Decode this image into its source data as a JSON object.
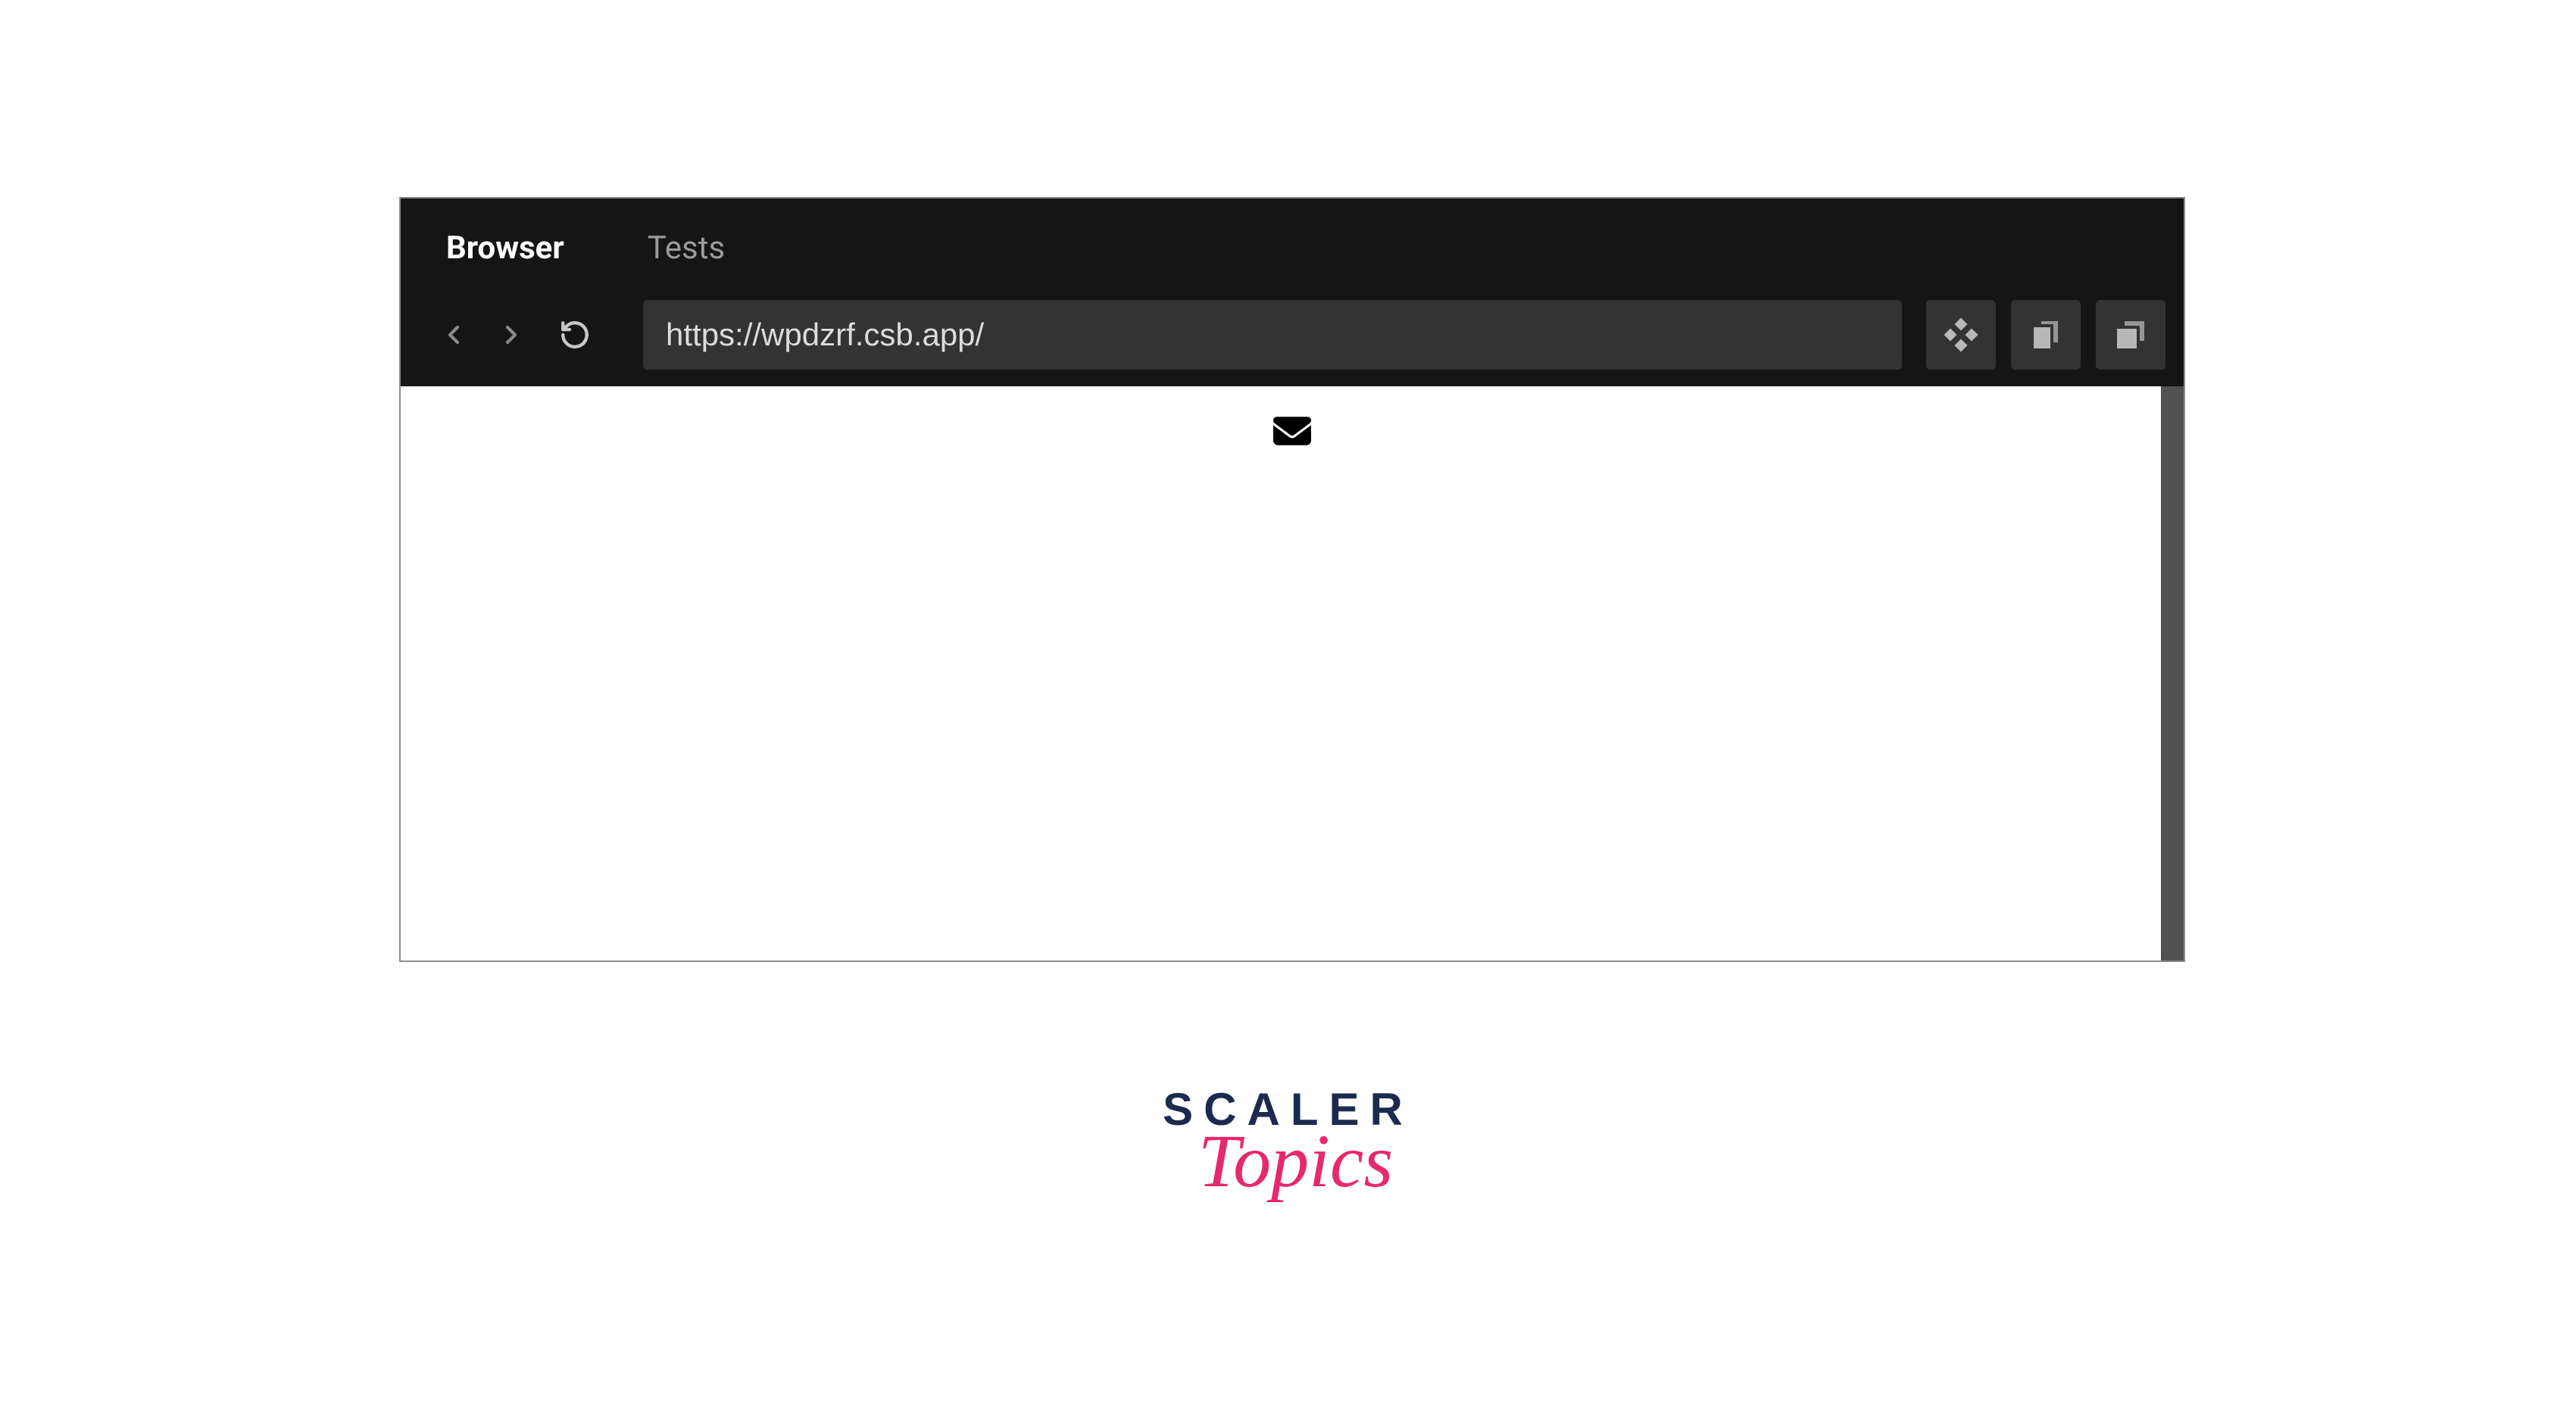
{
  "tabs": {
    "browser": "Browser",
    "tests": "Tests"
  },
  "toolbar": {
    "url": "https://wpdzrf.csb.app/"
  },
  "logo": {
    "line1": "SCALER",
    "line2": "Topics"
  }
}
